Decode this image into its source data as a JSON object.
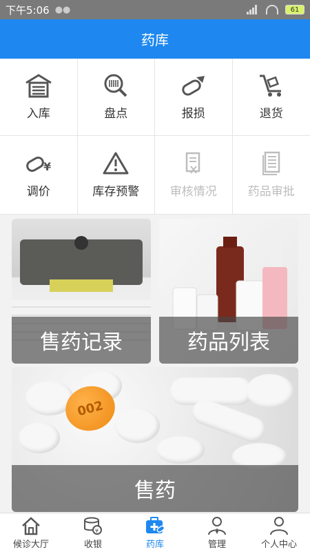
{
  "status": {
    "time": "下午5:06",
    "battery": "61"
  },
  "header": {
    "title": "药库"
  },
  "grid": [
    {
      "label": "入库",
      "icon": "warehouse-icon",
      "enabled": true
    },
    {
      "label": "盘点",
      "icon": "inventory-scan-icon",
      "enabled": true
    },
    {
      "label": "报损",
      "icon": "damaged-pill-icon",
      "enabled": true
    },
    {
      "label": "退货",
      "icon": "return-cart-icon",
      "enabled": true
    },
    {
      "label": "调价",
      "icon": "price-adjust-icon",
      "enabled": true
    },
    {
      "label": "库存预警",
      "icon": "warning-icon",
      "enabled": true
    },
    {
      "label": "审核情况",
      "icon": "review-status-icon",
      "enabled": false
    },
    {
      "label": "药品审批",
      "icon": "approval-doc-icon",
      "enabled": false
    }
  ],
  "cards": [
    {
      "label": "售药记录"
    },
    {
      "label": "药品列表"
    },
    {
      "label": "售药"
    }
  ],
  "tabs": [
    {
      "label": "候诊大厅",
      "icon": "home-icon"
    },
    {
      "label": "收银",
      "icon": "cashier-icon"
    },
    {
      "label": "药库",
      "icon": "medkit-icon"
    },
    {
      "label": "管理",
      "icon": "manager-icon"
    },
    {
      "label": "个人中心",
      "icon": "user-icon"
    }
  ],
  "colors": {
    "accent": "#1e88f0",
    "status_bar": "#7a7a7a",
    "disabled": "#bdbdbd"
  }
}
